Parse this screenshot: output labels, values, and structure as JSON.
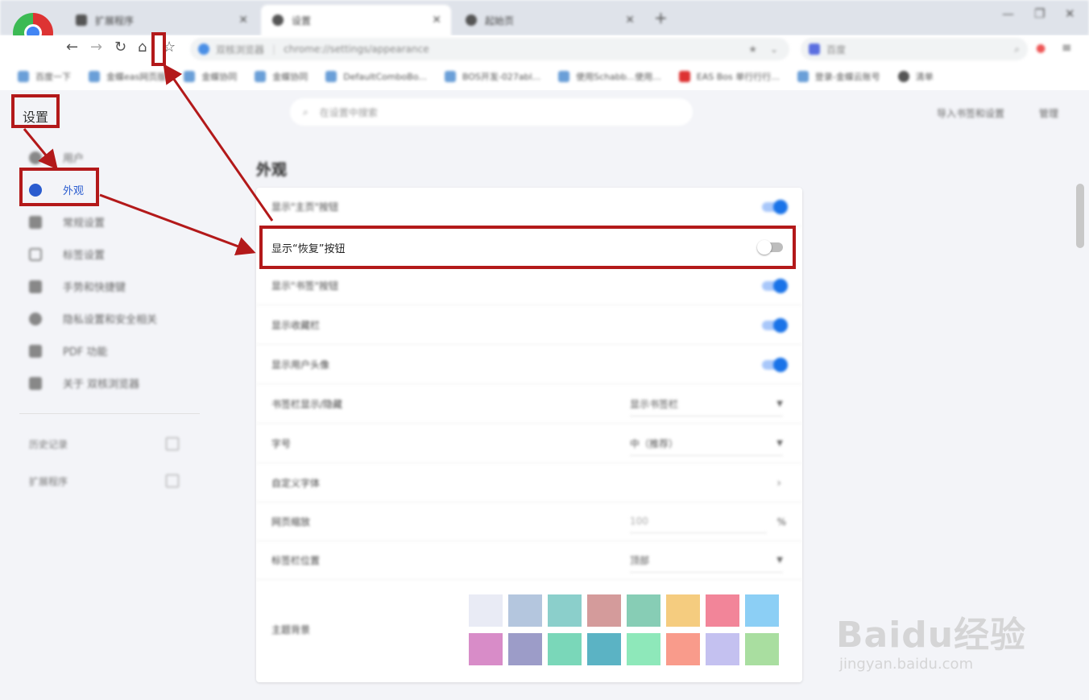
{
  "browser": {
    "tabs": [
      {
        "label": "扩展程序"
      },
      {
        "label": "设置"
      },
      {
        "label": "起始页"
      }
    ],
    "new_tab": "+",
    "address": {
      "site": "双核浏览器",
      "url": "chrome://settings/appearance"
    },
    "search_placeholder": "百度",
    "bookmarks": [
      "百度一下",
      "金蝶eas网页版",
      "金蝶协同",
      "金蝶协同",
      "DefaultComboBo...",
      "BOS开发-027abl...",
      "使用Schabb...使用...",
      "EAS Bos 单行行行...",
      "登录-金蝶云账号",
      "清单"
    ]
  },
  "settings": {
    "title": "设置",
    "search_placeholder": "在设置中搜索",
    "header_links": [
      "导入书签和设置",
      "管理"
    ],
    "sidebar": {
      "items": [
        {
          "label": "用户"
        },
        {
          "label": "外观"
        },
        {
          "label": "常规设置"
        },
        {
          "label": "标签设置"
        },
        {
          "label": "手势和快捷键"
        },
        {
          "label": "隐私设置和安全相关"
        },
        {
          "label": "PDF 功能"
        },
        {
          "label": "关于 双核浏览器"
        }
      ],
      "links": [
        "历史记录",
        "扩展程序"
      ]
    },
    "section_title": "外观",
    "rows": {
      "show_home": "显示\"主页\"按钮",
      "show_restore": "显示“恢复”按钮",
      "show_bookmark": "显示\"书签\"按钮",
      "show_bookmarks_bar": "显示收藏栏",
      "show_avatar": "显示用户头像",
      "bookmarks_bar_label": "书签栏显示/隐藏",
      "bookmarks_bar_value": "显示书签栏",
      "font_size_label": "字号",
      "font_size_value": "中（推荐）",
      "custom_fonts_label": "自定义字体",
      "page_zoom_label": "网页缩放",
      "page_zoom_value": "100",
      "page_zoom_unit": "%",
      "tab_position_label": "标签栏位置",
      "tab_position_value": "顶部",
      "theme_label": "主题背景"
    },
    "toggles": {
      "show_home": true,
      "show_restore": false,
      "show_bookmark": true,
      "show_bookmarks_bar": true,
      "show_avatar": true
    },
    "theme_colors": [
      "#e9ebf5",
      "#b4c6de",
      "#8bcfcb",
      "#d49b9b",
      "#87cdb5",
      "#f5cc7f",
      "#f28599",
      "#8ccff5",
      "#d88cc8",
      "#9c9cc8",
      "#7ad7b9",
      "#5bb3c4",
      "#8ee8ba",
      "#f99b8b",
      "#c4c1f0",
      "#a9dea0"
    ]
  },
  "watermark": {
    "brand": "Baidu经验",
    "url": "jingyan.baidu.com"
  },
  "colors": {
    "annotation_red": "#b3191a",
    "accent_blue": "#1a73e8"
  }
}
